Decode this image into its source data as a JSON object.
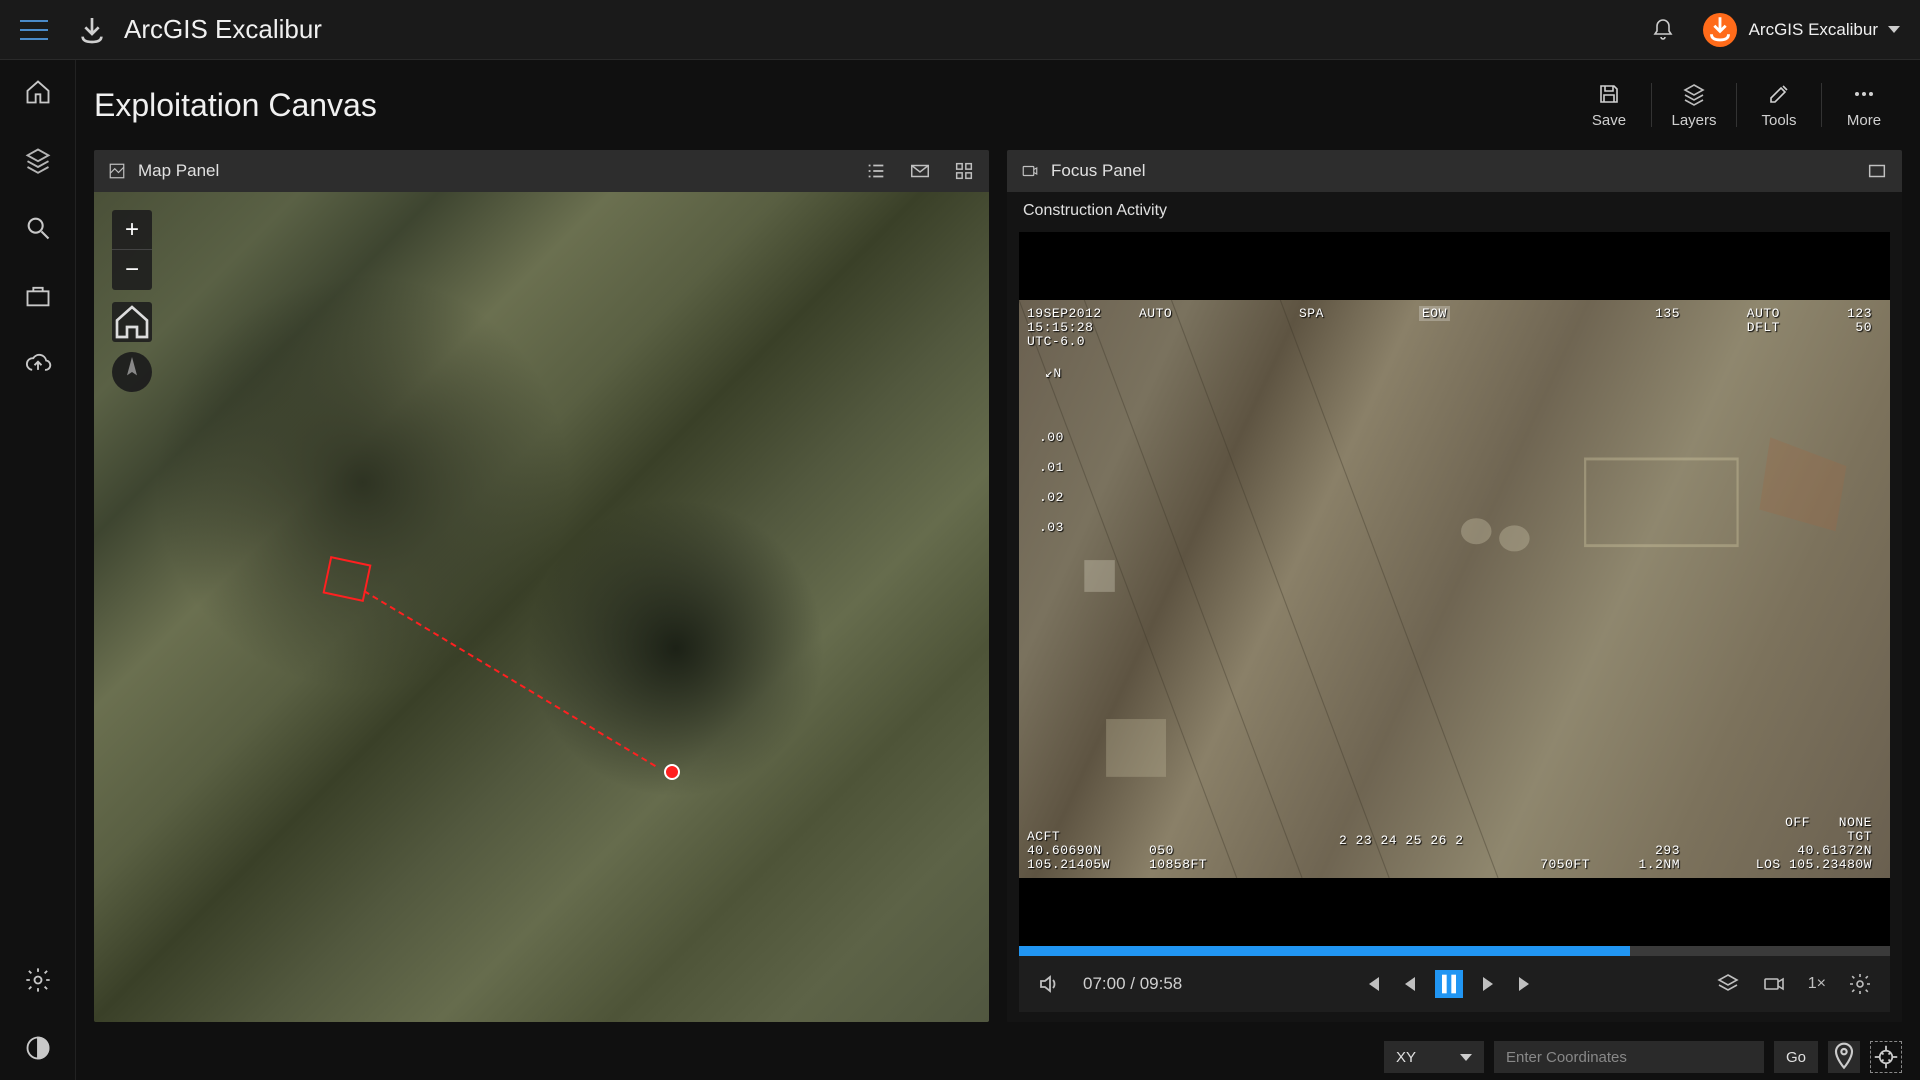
{
  "header": {
    "app_title": "ArcGIS Excalibur",
    "user_name": "ArcGIS Excalibur"
  },
  "page": {
    "title": "Exploitation Canvas"
  },
  "actions": {
    "save": "Save",
    "layers": "Layers",
    "tools": "Tools",
    "more": "More"
  },
  "map_panel": {
    "title": "Map Panel"
  },
  "focus_panel": {
    "title": "Focus Panel",
    "subject": "Construction Activity"
  },
  "hud": {
    "date": "19SEP2012",
    "time": "15:15:28",
    "utc": "UTC-6.0",
    "auto1": "AUTO",
    "spa": "SPA",
    "eow": "EOW",
    "v135": "135",
    "auto2": "AUTO",
    "v123": "123",
    "dflt": "DFLT",
    "v50": "50",
    "north": "N",
    "m00": ".00",
    "m01": ".01",
    "m02": ".02",
    "m03": ".03",
    "acft": "ACFT",
    "lat1": "40.60690N",
    "lon1": "105.21405W",
    "alt050": "050",
    "ft1": "10858FT",
    "scale": "2  23  24  25  26  2",
    "ft2": "7050FT",
    "v293": "293",
    "nm": "1.2NM",
    "off": "OFF",
    "none": "NONE",
    "tgt": "TGT",
    "lat2": "40.61372N",
    "los": "LOS 105.23480W"
  },
  "video": {
    "time_current": "07:00",
    "time_sep": " / ",
    "time_total": "09:58",
    "speed": "1×"
  },
  "bottom": {
    "coord_type": "XY",
    "placeholder": "Enter Coordinates",
    "go": "Go"
  }
}
